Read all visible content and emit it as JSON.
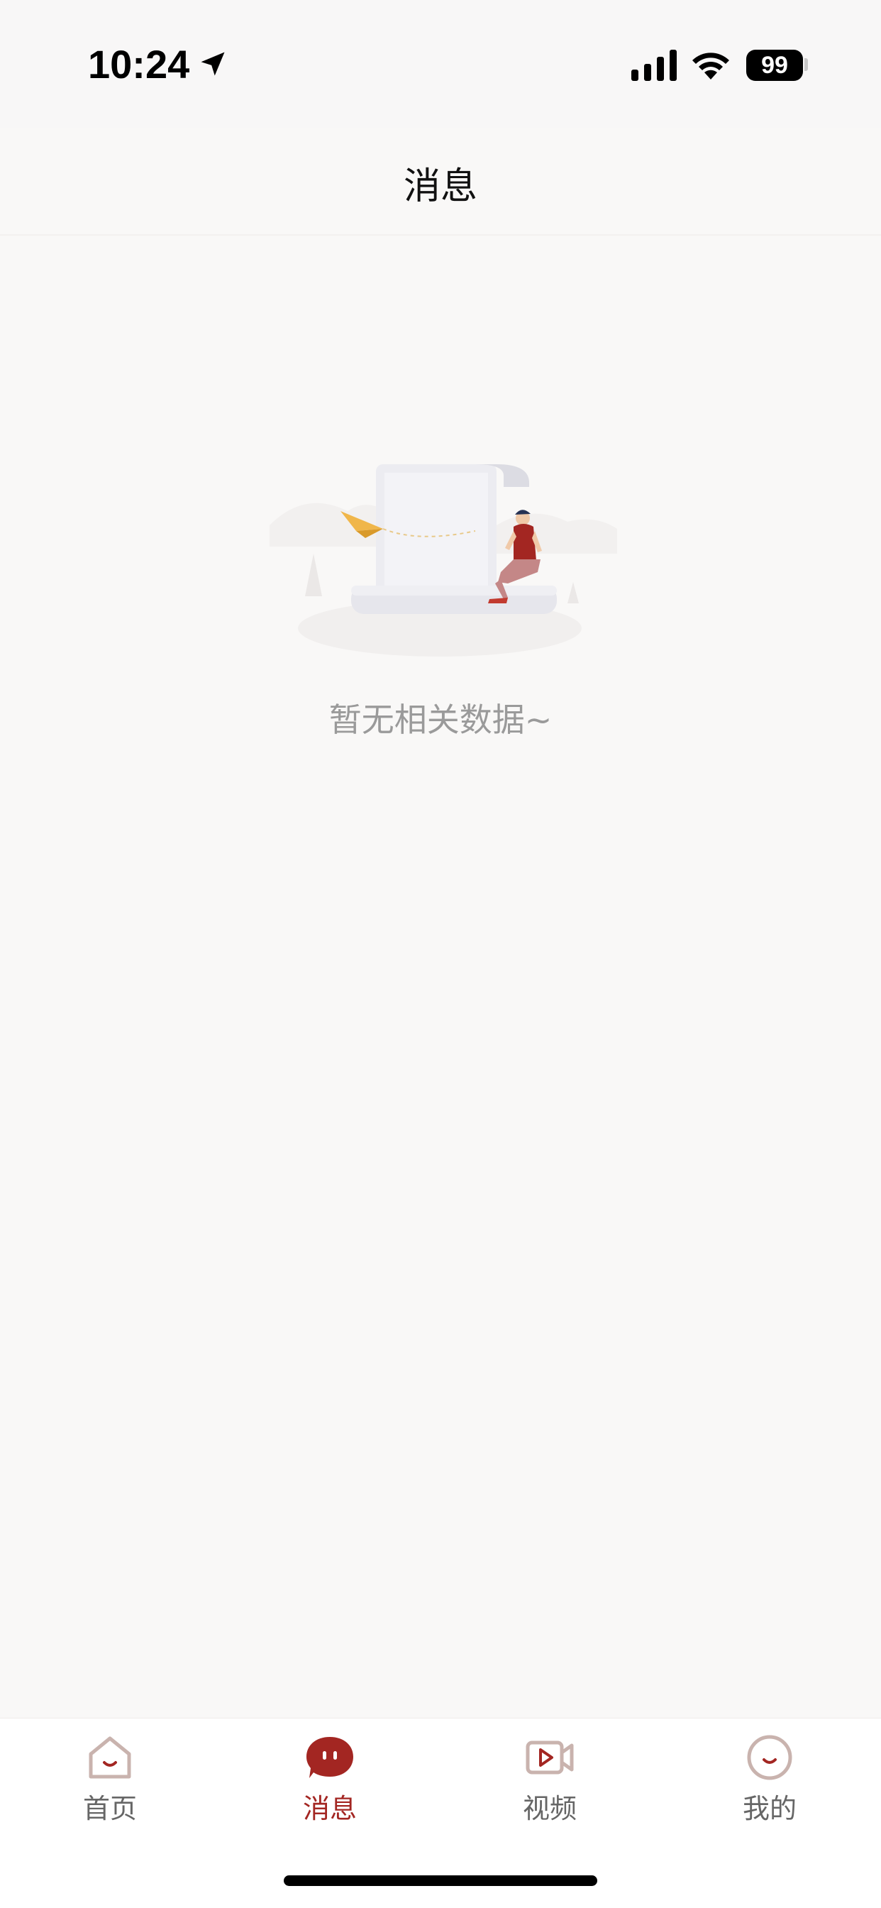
{
  "status_bar": {
    "time": "10:24",
    "battery": "99",
    "icons": [
      "location-arrow-icon",
      "cellular-signal-icon",
      "wifi-icon",
      "battery-icon"
    ]
  },
  "header": {
    "title": "消息"
  },
  "empty_state": {
    "illustration": "empty-document-illustration",
    "text": "暂无相关数据~"
  },
  "tab_bar": {
    "active_tab": "messages",
    "tabs": [
      {
        "id": "home",
        "label": "首页",
        "icon": "home-icon"
      },
      {
        "id": "messages",
        "label": "消息",
        "icon": "message-bubble-icon"
      },
      {
        "id": "video",
        "label": "视频",
        "icon": "video-camera-icon"
      },
      {
        "id": "mine",
        "label": "我的",
        "icon": "smile-face-icon"
      }
    ]
  },
  "colors": {
    "accent": "#a32622",
    "background": "#f9f8f7",
    "inactive_tab_icon": "#c9b3ae",
    "inactive_tab_label": "#666666",
    "empty_text": "#9a9a9a"
  }
}
